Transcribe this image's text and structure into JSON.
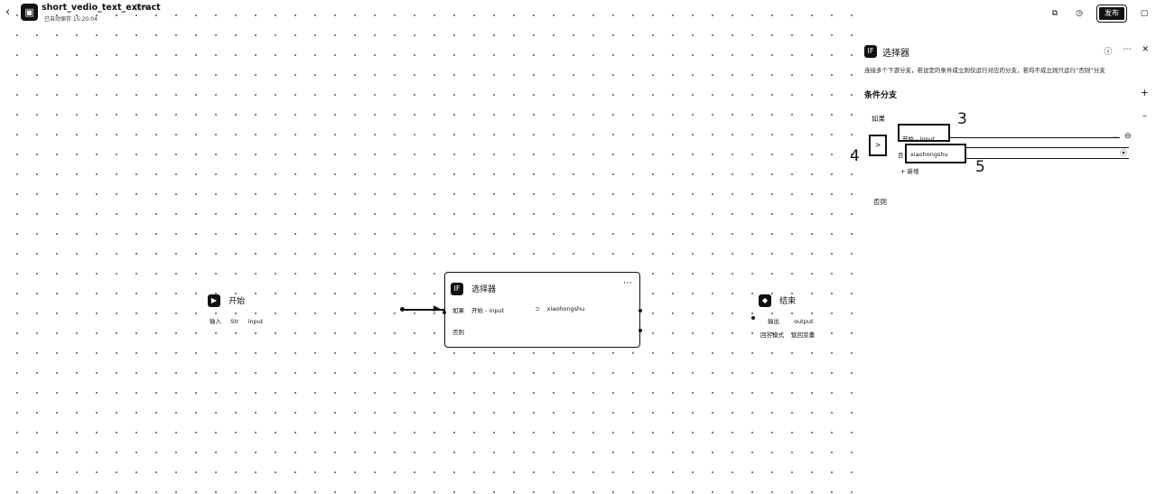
{
  "topbar": {
    "back_icon": "chevron-left-icon",
    "app_title": "short_vedio_text_extract",
    "app_subtitle": "已自动保存 15:20:04",
    "publish_label": "发布"
  },
  "canvas": {
    "start_node": {
      "title": "开始",
      "row_label": "输入",
      "row_type": "Str",
      "row_value": "input"
    },
    "selector_node": {
      "title": "选择器",
      "if_label": "如果",
      "source": "开始 - input",
      "operator": "⊃",
      "value": "xiaohongshu",
      "else_label": "否则"
    },
    "end_node": {
      "title": "结束",
      "row_label": "输出",
      "row_value": "output",
      "mode_label": "回答模式",
      "mode_value": "返回变量"
    }
  },
  "panel": {
    "title": "选择器",
    "description": "连接多个下游分支，若设定的条件成立则仅运行对应的分支，若均不成立则只运行“否则”分支",
    "section_title": "条件分支",
    "if_label": "如果",
    "variable": "开始 - input",
    "operator": ">",
    "and_label": "且",
    "value": "xiaohongshu",
    "add_condition_label": "+ 新增",
    "else_label": "否则",
    "annotations": [
      "3",
      "4",
      "5"
    ]
  }
}
